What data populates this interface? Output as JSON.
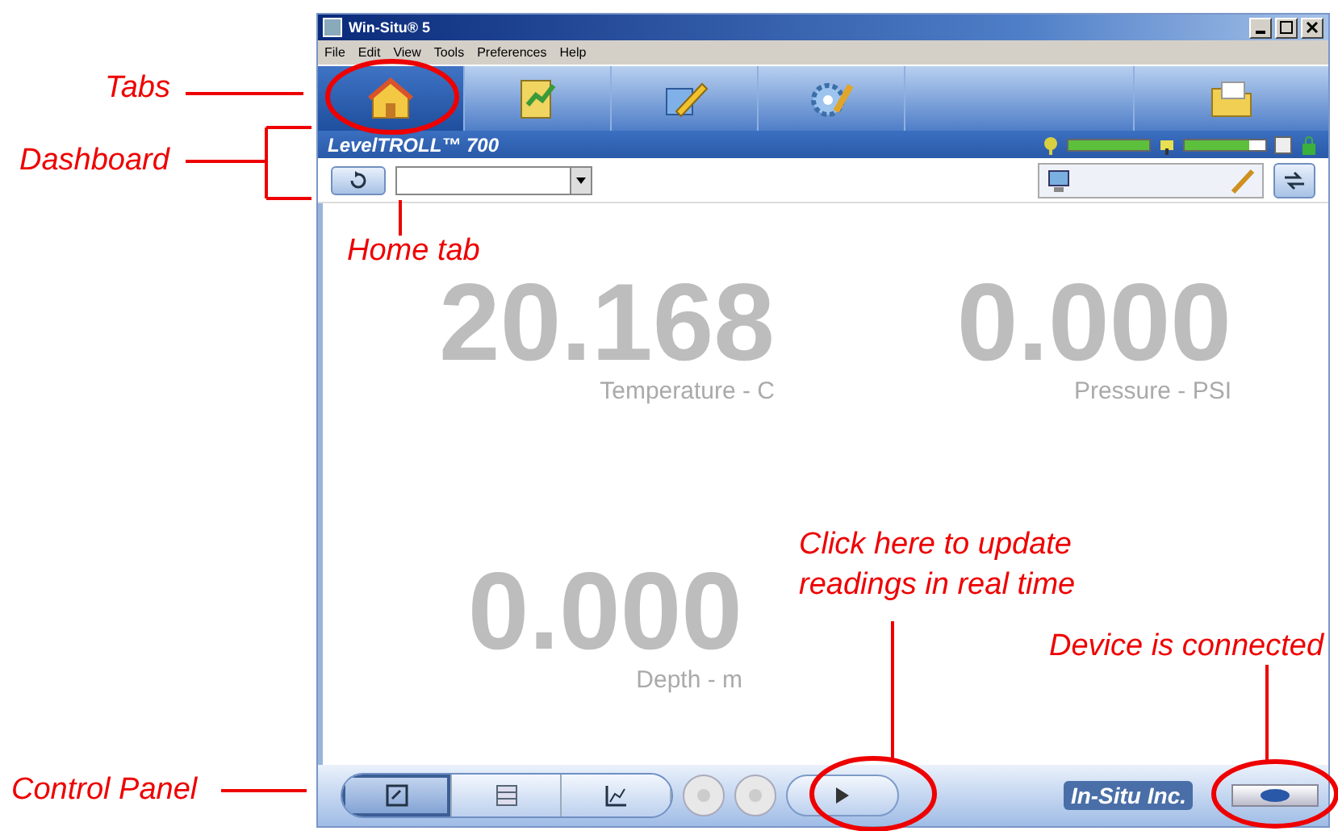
{
  "window": {
    "title": "Win-Situ® 5"
  },
  "menu": [
    "File",
    "Edit",
    "View",
    "Tools",
    "Preferences",
    "Help"
  ],
  "tabs": [
    {
      "kind": "home",
      "selected": true
    },
    {
      "kind": "data",
      "selected": false
    },
    {
      "kind": "edit",
      "selected": false
    },
    {
      "kind": "settings",
      "selected": false
    },
    {
      "kind": "files",
      "selected": false
    }
  ],
  "dashboard": {
    "device": "LevelTROLL™ 700",
    "batteries": [
      {
        "kind": "signal",
        "level": 1.0
      },
      {
        "kind": "power",
        "level": 0.8
      }
    ]
  },
  "readings": [
    {
      "value": "20.168",
      "label": "Temperature - C"
    },
    {
      "value": "0.000",
      "label": "Pressure - PSI"
    },
    {
      "value": "0.000",
      "label": "Depth - m"
    }
  ],
  "control_panel": {
    "views": [
      {
        "kind": "meter",
        "selected": true
      },
      {
        "kind": "list",
        "selected": false
      },
      {
        "kind": "graph",
        "selected": false
      }
    ],
    "logo": "In-Situ Inc.",
    "connected": true
  },
  "annotations": [
    {
      "kind": "tabs",
      "text": "Tabs"
    },
    {
      "kind": "dashboard",
      "text": "Dashboard"
    },
    {
      "kind": "home_tab",
      "text": "Home tab"
    },
    {
      "kind": "update",
      "text": "Click here to update readings in real time"
    },
    {
      "kind": "connected",
      "text": "Device is connected"
    },
    {
      "kind": "control_panel",
      "text": "Control Panel"
    }
  ]
}
